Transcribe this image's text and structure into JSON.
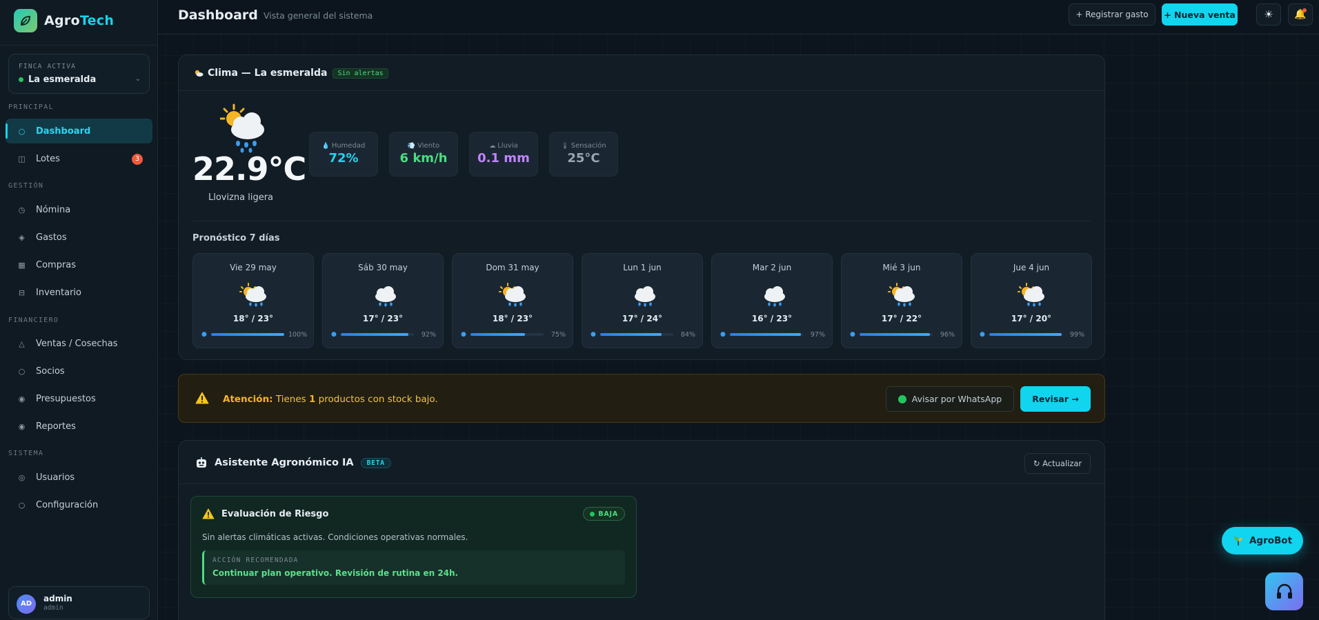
{
  "brand": {
    "name_prefix": "Agro",
    "name_accent": "Tech",
    "logo_icon": "leaf-icon"
  },
  "farm": {
    "label": "FINCA ACTIVA",
    "value": "La esmeralda"
  },
  "sidebar": {
    "sections": [
      {
        "label": "PRINCIPAL"
      },
      {
        "label": "GESTIÓN"
      },
      {
        "label": "FINANCIERO"
      },
      {
        "label": "SISTEMA"
      }
    ],
    "items": [
      {
        "label": "Dashboard",
        "icon": "○"
      },
      {
        "label": "Lotes",
        "icon": "◫",
        "badge": "3"
      },
      {
        "label": "Nómina",
        "icon": "◷"
      },
      {
        "label": "Gastos",
        "icon": "◈"
      },
      {
        "label": "Compras",
        "icon": "▦"
      },
      {
        "label": "Inventario",
        "icon": "⊟"
      },
      {
        "label": "Ventas / Cosechas",
        "icon": "△"
      },
      {
        "label": "Socios",
        "icon": "○"
      },
      {
        "label": "Presupuestos",
        "icon": "◉"
      },
      {
        "label": "Reportes",
        "icon": "◉"
      },
      {
        "label": "Usuarios",
        "icon": "◎"
      },
      {
        "label": "Configuración",
        "icon": "○"
      }
    ]
  },
  "user": {
    "initials": "AD",
    "name": "admin",
    "role": "admin"
  },
  "header": {
    "title": "Dashboard",
    "subtitle": "Vista general del sistema",
    "expense_button": "+ Registrar gasto",
    "sale_button": "+ Nueva venta",
    "theme_icon": "☀",
    "bell_icon": "🔔"
  },
  "weather": {
    "title": "Clima — La esmeralda",
    "status_pill": "Sin alertas",
    "temperature": "22.9°C",
    "description": "Llovizna ligera",
    "metrics": [
      {
        "label": "Humedad",
        "value": "72%",
        "color": "#22d3ee",
        "icon": "💧"
      },
      {
        "label": "Viento",
        "value": "6 km/h",
        "color": "#4ade80",
        "icon": "💨"
      },
      {
        "label": "Lluvia",
        "value": "0.1 mm",
        "color": "#c084fc",
        "icon": "☁"
      },
      {
        "label": "Sensación",
        "value": "25°C",
        "color": "#9aa6af",
        "icon": "🌡"
      }
    ],
    "forecast_title": "Pronóstico 7 días",
    "forecast": [
      {
        "day": "Vie 29 may",
        "temps": "18° / 23°",
        "rain_pct": "100%",
        "rain": 1.0,
        "sun": true
      },
      {
        "day": "Sáb 30 may",
        "temps": "17° / 23°",
        "rain_pct": "92%",
        "rain": 0.92,
        "sun": false
      },
      {
        "day": "Dom 31 may",
        "temps": "18° / 23°",
        "rain_pct": "75%",
        "rain": 0.75,
        "sun": true
      },
      {
        "day": "Lun 1 jun",
        "temps": "17° / 24°",
        "rain_pct": "84%",
        "rain": 0.84,
        "sun": false
      },
      {
        "day": "Mar 2 jun",
        "temps": "16° / 23°",
        "rain_pct": "97%",
        "rain": 0.97,
        "sun": false
      },
      {
        "day": "Mié 3 jun",
        "temps": "17° / 22°",
        "rain_pct": "96%",
        "rain": 0.96,
        "sun": true
      },
      {
        "day": "Jue 4 jun",
        "temps": "17° / 20°",
        "rain_pct": "99%",
        "rain": 0.99,
        "sun": true
      }
    ]
  },
  "alert": {
    "prefix": "Atención:",
    "text_before": " Tienes ",
    "count": "1",
    "text_after": " productos con stock bajo.",
    "whatsapp_button": "Avisar por WhatsApp",
    "review_button": "Revisar →"
  },
  "assistant": {
    "title": "Asistente Agronómico IA",
    "beta": "BETA",
    "refresh_button": "↻ Actualizar",
    "risk": {
      "title": "Evaluación de Riesgo",
      "level": "BAJA",
      "description": "Sin alertas climáticas activas. Condiciones operativas normales.",
      "action_label": "ACCIÓN RECOMENDADA",
      "action_text": "Continuar plan operativo. Revisión de rutina en 24h."
    }
  },
  "floating": {
    "agrobot_label": "AgroBot"
  }
}
